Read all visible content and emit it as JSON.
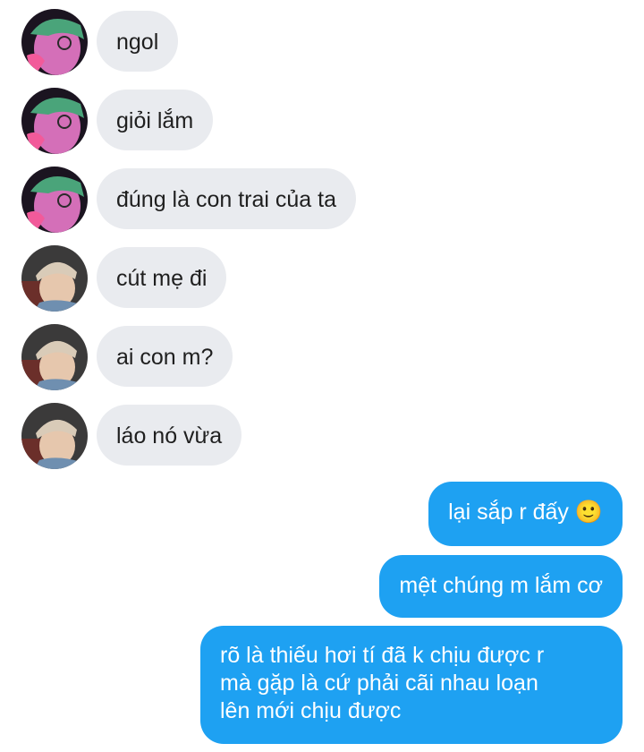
{
  "conversation": {
    "incoming": [
      {
        "sender": "friend",
        "text": "ngol"
      },
      {
        "sender": "friend",
        "text": "giỏi lắm"
      },
      {
        "sender": "friend",
        "text": "đúng là con trai của ta"
      },
      {
        "sender": "other",
        "text": "cút mẹ đi"
      },
      {
        "sender": "other",
        "text": "ai con m?"
      },
      {
        "sender": "other",
        "text": "láo nó vừa"
      }
    ],
    "outgoing": [
      {
        "text": "lại sắp r đấy 🙂"
      },
      {
        "text": "mệt chúng m lắm cơ"
      },
      {
        "lines": [
          "rõ là thiếu hơi tí đã k chịu được r",
          "mà gặp là cứ phải cãi nhau loạn",
          "lên mới chịu được"
        ]
      }
    ]
  },
  "colors": {
    "incoming_bubble": "#e9ebef",
    "outgoing_bubble": "#1ea1f2",
    "incoming_text": "#1f1f1f",
    "outgoing_text": "#ffffff"
  }
}
